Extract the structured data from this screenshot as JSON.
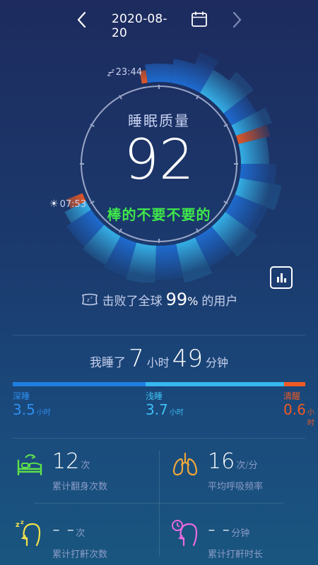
{
  "header": {
    "date": "2020-08-20",
    "prev_icon": "chevron-left-icon",
    "next_icon": "chevron-right-icon",
    "calendar_icon": "calendar-icon"
  },
  "gauge": {
    "sleep_time": "23:44",
    "wake_time": "07:53",
    "quality_label": "睡眠质量",
    "score": "92",
    "comment": "棒的不要不要的",
    "colors": {
      "deep": "#1f6fd6",
      "light": "#36b7ee",
      "awake": "#ef5a22",
      "ring": "#9aa6c6"
    }
  },
  "beat": {
    "prefix": "击败了全球",
    "percent": "99",
    "percent_sign": "%",
    "suffix": "的用户"
  },
  "total": {
    "prefix": "我睡了",
    "hours": "7",
    "hours_unit": "小时",
    "minutes": "49",
    "minutes_unit": "分钟"
  },
  "stages": [
    {
      "name": "深睡",
      "value": "3.5",
      "unit": "小时",
      "color": "#1e7fe0"
    },
    {
      "name": "浅睡",
      "value": "3.7",
      "unit": "小时",
      "color": "#37b8ef"
    },
    {
      "name": "清醒",
      "value": "0.6",
      "unit": "小时",
      "color": "#ef5a22"
    }
  ],
  "stats": {
    "turnover": {
      "value": "12",
      "unit": "次",
      "label": "累计翻身次数",
      "icon": "bed-icon"
    },
    "breath": {
      "value": "16",
      "unit": "次/分",
      "label": "平均呼吸频率",
      "icon": "lungs-icon"
    },
    "snore_count": {
      "value": "- -",
      "unit": "次",
      "label": "累计打鼾次数",
      "icon": "snore-head-icon"
    },
    "snore_time": {
      "value": "- -",
      "unit": "分钟",
      "label": "累计打鼾时长",
      "icon": "snore-clock-icon"
    }
  }
}
